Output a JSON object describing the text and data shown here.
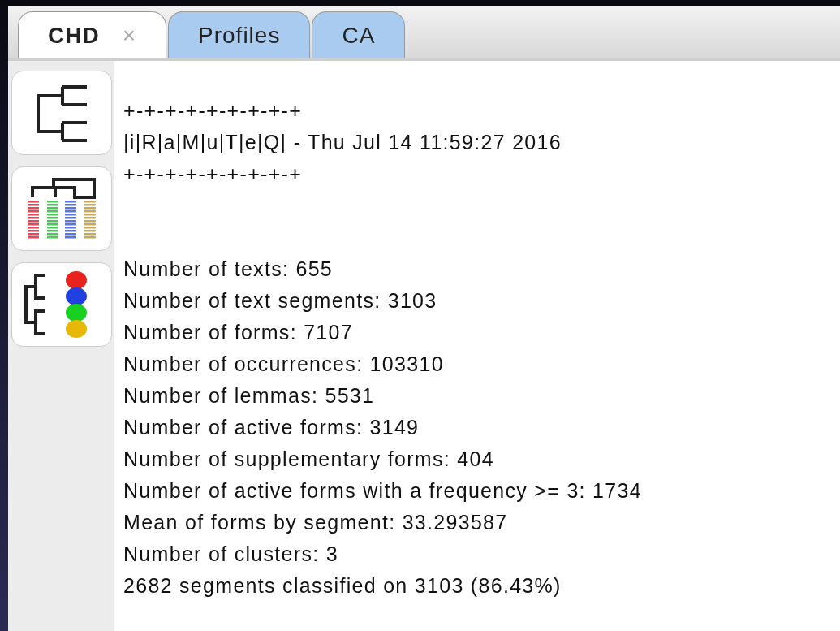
{
  "tabs": [
    {
      "label": "CHD",
      "selected": true,
      "close": "×"
    },
    {
      "label": "Profiles",
      "selected": false
    },
    {
      "label": "CA",
      "selected": false
    }
  ],
  "tools": [
    {
      "kind": "dendrogram"
    },
    {
      "kind": "profiles"
    },
    {
      "kind": "clusters"
    }
  ],
  "header": [
    "+-+-+-+-+-+-+-+-+",
    "|i|R|a|M|u|T|e|Q| - Thu Jul 14 11:59:27 2016",
    "+-+-+-+-+-+-+-+-+"
  ],
  "stats": [
    "Number of texts: 655",
    "Number of text segments: 3103",
    "Number of forms: 7107",
    "Number of occurrences: 103310",
    "Number of lemmas: 5531",
    "Number of active forms: 3149",
    "Number of supplementary forms: 404",
    "Number of active forms with a frequency >= 3: 1734",
    "Mean of forms by segment: 33.293587",
    "Number of clusters: 3",
    "2682 segments classified on 3103 (86.43%)"
  ]
}
